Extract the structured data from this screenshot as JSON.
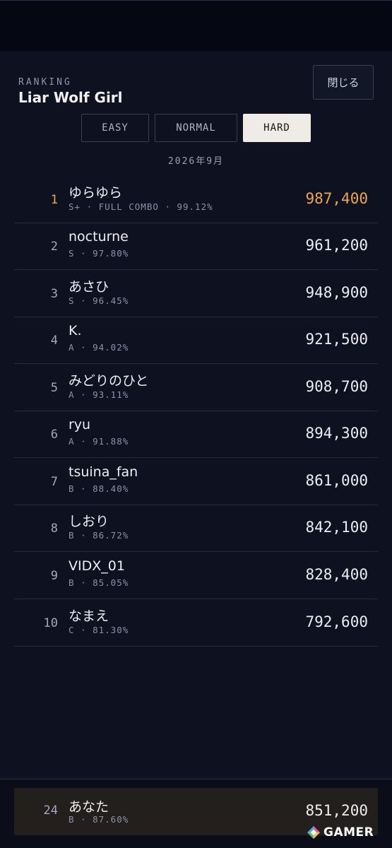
{
  "header": {
    "eyebrow": "RANKING",
    "title": "Liar Wolf Girl",
    "close_label": "閉じる"
  },
  "tabs": [
    {
      "label": "EASY",
      "active": false
    },
    {
      "label": "NORMAL",
      "active": false
    },
    {
      "label": "HARD",
      "active": true
    }
  ],
  "period": "2026年9月",
  "ranking": [
    {
      "rank": "1",
      "name": "ゆらゆら",
      "sub": "S+ · FULL COMBO · 99.12%",
      "score": "987,400"
    },
    {
      "rank": "2",
      "name": "nocturne",
      "sub": "S · 97.80%",
      "score": "961,200"
    },
    {
      "rank": "3",
      "name": "あさひ",
      "sub": "S · 96.45%",
      "score": "948,900"
    },
    {
      "rank": "4",
      "name": "K.",
      "sub": "A · 94.02%",
      "score": "921,500"
    },
    {
      "rank": "5",
      "name": "みどりのひと",
      "sub": "A · 93.11%",
      "score": "908,700"
    },
    {
      "rank": "6",
      "name": "ryu",
      "sub": "A · 91.88%",
      "score": "894,300"
    },
    {
      "rank": "7",
      "name": "tsuina_fan",
      "sub": "B · 88.40%",
      "score": "861,000"
    },
    {
      "rank": "8",
      "name": "しおり",
      "sub": "B · 86.72%",
      "score": "842,100"
    },
    {
      "rank": "9",
      "name": "VIDX_01",
      "sub": "B · 85.05%",
      "score": "828,400"
    },
    {
      "rank": "10",
      "name": "なまえ",
      "sub": "C · 81.30%",
      "score": "792,600"
    }
  ],
  "me": {
    "rank": "24",
    "name": "あなた",
    "sub": "B · 87.60%",
    "score": "851,200"
  },
  "watermark": {
    "text": "GAMER",
    "icon": "gamer-logo-icon"
  },
  "colors": {
    "accent_gold": "#f0a64a",
    "active_tab_bg": "#efece6",
    "background": "#0d1120"
  }
}
